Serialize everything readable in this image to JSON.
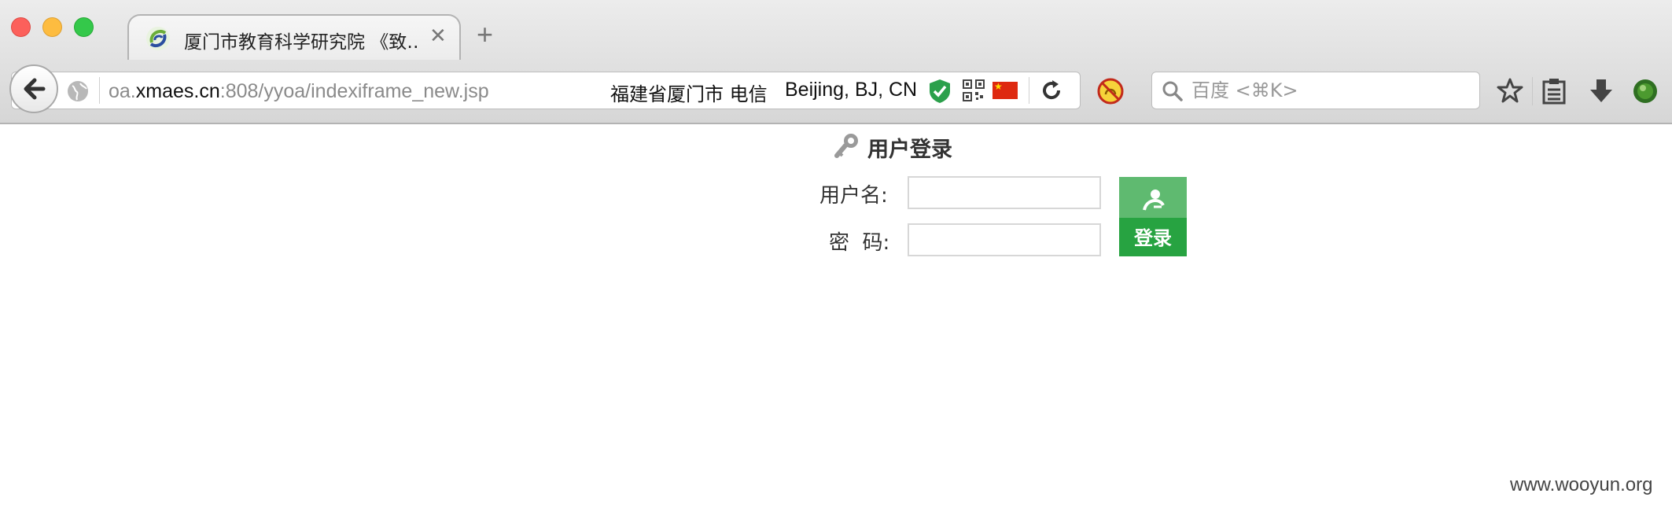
{
  "browser": {
    "tab_title": "厦门市教育科学研究院 《致…",
    "tab_close": "✕",
    "new_tab": "+",
    "url_prefix": "oa.",
    "url_host": "xmaes.cn",
    "url_path": ":808/yyoa/indexiframe_new.jsp",
    "geo_location": "福建省厦门市 电信",
    "server_location": "Beijing, BJ, CN",
    "search_placeholder": "百度 <⌘K>"
  },
  "login": {
    "title": "用户登录",
    "username_label": "用户名:",
    "password_label": "密  码:",
    "username_value": "",
    "password_value": "",
    "submit_label": "登录"
  },
  "watermark": "www.wooyun.org",
  "colors": {
    "login_button": "#27a341",
    "login_button_top": "#5fba70",
    "flag_red": "#de2910"
  }
}
